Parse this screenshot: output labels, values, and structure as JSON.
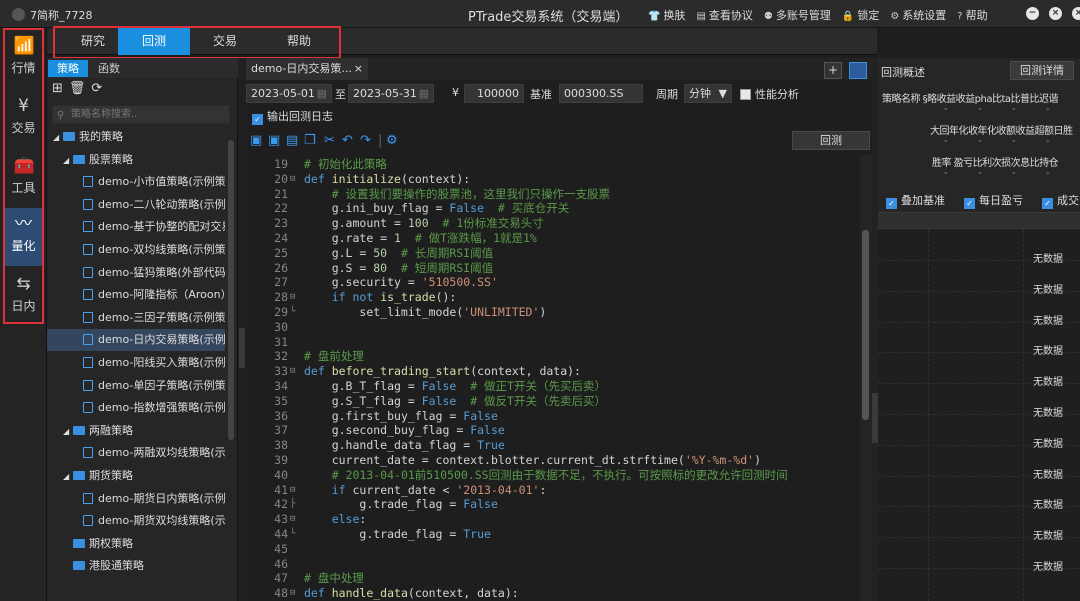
{
  "topbar": {
    "username": "7简称_7728",
    "app_title": "PTrade交易系统（交易端）",
    "menu": [
      {
        "icon": "shirt-icon",
        "glyph": "👕",
        "label": "换肤"
      },
      {
        "icon": "document-icon",
        "glyph": "▤",
        "label": "查看协议"
      },
      {
        "icon": "users-icon",
        "glyph": "⚉",
        "label": "多账号管理"
      },
      {
        "icon": "lock-icon",
        "glyph": "🔒",
        "label": "锁定"
      },
      {
        "icon": "gear-icon",
        "glyph": "⚙",
        "label": "系统设置"
      },
      {
        "icon": "help-icon",
        "glyph": "?",
        "label": "帮助"
      }
    ],
    "window_controls": [
      "−",
      "×",
      "×"
    ]
  },
  "rail": [
    {
      "label": "行情",
      "glyph": "📶",
      "icon": "chart-bars-icon",
      "active": false
    },
    {
      "label": "交易",
      "glyph": "¥",
      "icon": "yen-circle-icon",
      "active": false
    },
    {
      "label": "工具",
      "glyph": "🧰",
      "icon": "toolbox-icon",
      "active": false
    },
    {
      "label": "量化",
      "glyph": "〰",
      "icon": "wave-icon",
      "active": true
    },
    {
      "label": "日内",
      "glyph": "⇆",
      "icon": "intraday-icon",
      "active": false
    }
  ],
  "main_tabs": [
    {
      "label": "研究",
      "active": false
    },
    {
      "label": "回测",
      "active": true
    },
    {
      "label": "交易",
      "active": false
    },
    {
      "label": "帮助",
      "active": false
    }
  ],
  "strategy_panel": {
    "tabs": [
      {
        "label": "策略",
        "active": true
      },
      {
        "label": "函数",
        "active": false
      }
    ],
    "search_placeholder": "策略名称搜索..",
    "tree": [
      {
        "label": "我的策略",
        "level": 0,
        "type": "folder",
        "open": true
      },
      {
        "label": "股票策略",
        "level": 1,
        "type": "folder",
        "open": true
      },
      {
        "label": "demo-小市值策略(示例策",
        "level": 2,
        "type": "file"
      },
      {
        "label": "demo-二八轮动策略(示例",
        "level": 2,
        "type": "file"
      },
      {
        "label": "demo-基于协整的配对交易",
        "level": 2,
        "type": "file"
      },
      {
        "label": "demo-双均线策略(示例策",
        "level": 2,
        "type": "file"
      },
      {
        "label": "demo-猛犸策略(外部代码",
        "level": 2,
        "type": "file"
      },
      {
        "label": "demo-阿隆指标（Aroon）",
        "level": 2,
        "type": "file"
      },
      {
        "label": "demo-三因子策略(示例策",
        "level": 2,
        "type": "file"
      },
      {
        "label": "demo-日内交易策略(示例",
        "level": 2,
        "type": "file",
        "selected": true
      },
      {
        "label": "demo-阳线买入策略(示例",
        "level": 2,
        "type": "file"
      },
      {
        "label": "demo-单因子策略(示例策",
        "level": 2,
        "type": "file"
      },
      {
        "label": "demo-指数增强策略(示例",
        "level": 2,
        "type": "file"
      },
      {
        "label": "两融策略",
        "level": 1,
        "type": "folder",
        "open": true
      },
      {
        "label": "demo-两融双均线策略(示",
        "level": 2,
        "type": "file"
      },
      {
        "label": "期货策略",
        "level": 1,
        "type": "folder",
        "open": true
      },
      {
        "label": "demo-期货日内策略(示例",
        "level": 2,
        "type": "file"
      },
      {
        "label": "demo-期货双均线策略(示",
        "level": 2,
        "type": "file"
      },
      {
        "label": "期权策略",
        "level": 1,
        "type": "folder",
        "open": false
      },
      {
        "label": "港股通策略",
        "level": 1,
        "type": "folder",
        "open": false
      }
    ]
  },
  "editor": {
    "tab_title": "demo-日内交易策...",
    "tab_close": "×",
    "plus_label": "+",
    "params": {
      "start_date": "2023-05-01",
      "to_label": "至",
      "end_date": "2023-05-31",
      "currency_symbol": "¥",
      "capital": "100000",
      "benchmark_label": "基准",
      "benchmark": "000300.SS",
      "period_label": "周期",
      "period": "分钟",
      "perf_label": "性能分析"
    },
    "log_label": "输出回测日志",
    "backtest_button": "回测",
    "code_lines": [
      {
        "n": "19",
        "fold": "",
        "html": "<span class='cm'># 初始化此策略</span>"
      },
      {
        "n": "20",
        "fold": "⊟",
        "html": "<span class='k'>def</span> <span class='fn'>initialize</span><span class='pl'>(context):</span>"
      },
      {
        "n": "21",
        "fold": "",
        "html": "    <span class='cm'># 设置我们要操作的股票池，这里我们只操作一支股票</span>"
      },
      {
        "n": "22",
        "fold": "",
        "html": "    <span class='pl'>g.ini_buy_flag = </span><span class='k'>False</span>  <span class='cm'># 买底仓开关</span>"
      },
      {
        "n": "23",
        "fold": "",
        "html": "    <span class='pl'>g.amount = </span><span class='nm'>100</span>  <span class='cm'># 1份标准交易头寸</span>"
      },
      {
        "n": "24",
        "fold": "",
        "html": "    <span class='pl'>g.rate = </span><span class='nm'>1</span>  <span class='cm'># 做T涨跌幅，1就是1%</span>"
      },
      {
        "n": "25",
        "fold": "",
        "html": "    <span class='pl'>g.L = </span><span class='nm'>50</span>  <span class='cm'># 长周期RSI阈值</span>"
      },
      {
        "n": "26",
        "fold": "",
        "html": "    <span class='pl'>g.S = </span><span class='nm'>80</span>  <span class='cm'># 短周期RSI阈值</span>"
      },
      {
        "n": "27",
        "fold": "",
        "html": "    <span class='pl'>g.security = </span><span class='st'>'510500.SS'</span>"
      },
      {
        "n": "28",
        "fold": "⊟",
        "html": "    <span class='k'>if not</span> <span class='fn'>is_trade</span><span class='pl'>():</span>"
      },
      {
        "n": "29",
        "fold": "└",
        "html": "        <span class='pl'>set_limit_mode(</span><span class='st'>'UNLIMITED'</span><span class='pl'>)</span>"
      },
      {
        "n": "30",
        "fold": "",
        "html": ""
      },
      {
        "n": "31",
        "fold": "",
        "html": ""
      },
      {
        "n": "32",
        "fold": "",
        "html": "<span class='cm'># 盘前处理</span>"
      },
      {
        "n": "33",
        "fold": "⊟",
        "html": "<span class='k'>def</span> <span class='fn'>before_trading_start</span><span class='pl'>(context, data):</span>"
      },
      {
        "n": "34",
        "fold": "",
        "html": "    <span class='pl'>g.B_T_flag = </span><span class='k'>False</span>  <span class='cm'># 做正T开关（先买后卖）</span>"
      },
      {
        "n": "35",
        "fold": "",
        "html": "    <span class='pl'>g.S_T_flag = </span><span class='k'>False</span>  <span class='cm'># 做反T开关（先卖后买）</span>"
      },
      {
        "n": "36",
        "fold": "",
        "html": "    <span class='pl'>g.first_buy_flag = </span><span class='k'>False</span>"
      },
      {
        "n": "37",
        "fold": "",
        "html": "    <span class='pl'>g.second_buy_flag = </span><span class='k'>False</span>"
      },
      {
        "n": "38",
        "fold": "",
        "html": "    <span class='pl'>g.handle_data_flag = </span><span class='k'>True</span>"
      },
      {
        "n": "39",
        "fold": "",
        "html": "    <span class='pl'>current_date = context.blotter.current_dt.strftime(</span><span class='st'>'%Y-%m-%d'</span><span class='pl'>)</span>"
      },
      {
        "n": "40",
        "fold": "",
        "html": "    <span class='cm'># 2013-04-01前510500.SS回测由于数据不足，不执行。可按照标的更改允许回测时间</span>"
      },
      {
        "n": "41",
        "fold": "⊟",
        "html": "    <span class='k'>if</span> <span class='pl'>current_date &lt; </span><span class='st'>'2013-04-01'</span><span class='pl'>:</span>"
      },
      {
        "n": "42",
        "fold": "├",
        "html": "        <span class='pl'>g.trade_flag = </span><span class='k'>False</span>"
      },
      {
        "n": "43",
        "fold": "⊟",
        "html": "    <span class='k'>else</span><span class='pl'>:</span>"
      },
      {
        "n": "44",
        "fold": "└",
        "html": "        <span class='pl'>g.trade_flag = </span><span class='k'>True</span>"
      },
      {
        "n": "45",
        "fold": "",
        "html": ""
      },
      {
        "n": "46",
        "fold": "",
        "html": ""
      },
      {
        "n": "47",
        "fold": "",
        "html": "<span class='cm'># 盘中处理</span>"
      },
      {
        "n": "48",
        "fold": "⊟",
        "html": "<span class='k'>def</span> <span class='fn'>handle_data</span><span class='pl'>(context, data):</span>"
      }
    ]
  },
  "right_panel": {
    "title": "回测概述",
    "detail_button": "回测详情",
    "row1": "策略名称 §略收益收益pha比ta比普比迟谐",
    "row2": "大回年化收年化收额收益超额日胜",
    "row3": "胜率 盈亏比利次损次息比持仓",
    "dash": "-",
    "checks": [
      "叠加基准",
      "每日盈亏",
      "成交"
    ],
    "no_data": "无数据"
  }
}
